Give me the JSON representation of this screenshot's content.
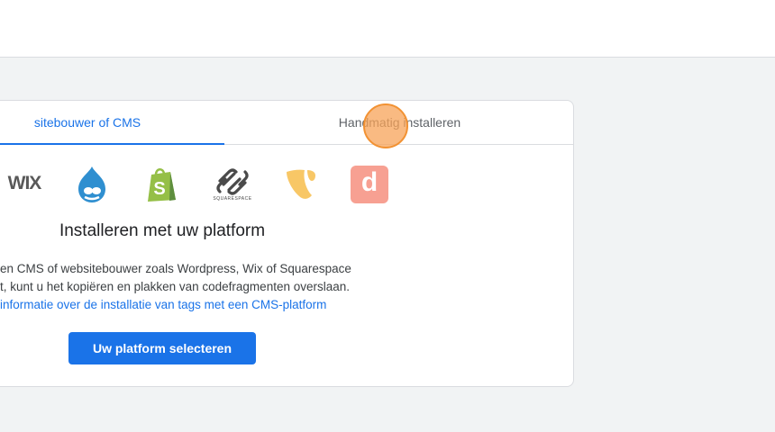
{
  "tabs": [
    {
      "label": "sitebouwer of CMS",
      "active": true
    },
    {
      "label": "Handmatig installeren",
      "active": false
    }
  ],
  "platforms": [
    {
      "name": "Wix",
      "icon": "wix-logo-icon",
      "text": "WIX"
    },
    {
      "name": "Drupal",
      "icon": "drupal-logo-icon"
    },
    {
      "name": "Shopify",
      "icon": "shopify-logo-icon",
      "text": "S"
    },
    {
      "name": "Squarespace",
      "icon": "squarespace-logo-icon",
      "text": "SQUARESPACE"
    },
    {
      "name": "TYPO3",
      "icon": "typo3-logo-icon"
    },
    {
      "name": "Duda",
      "icon": "duda-logo-icon",
      "text": "d"
    }
  ],
  "main": {
    "heading": "Installeren met uw platform",
    "desc_line1": "en CMS of websitebouwer zoals Wordpress, Wix of Squarespace",
    "desc_line2": "t, kunt u het kopiëren en plakken van codefragmenten overslaan.",
    "link": "informatie over de installatie van tags met een CMS-platform",
    "button": "Uw platform selecteren"
  },
  "colors": {
    "accent": "#1a73e8",
    "click_marker": "#f7a358"
  }
}
